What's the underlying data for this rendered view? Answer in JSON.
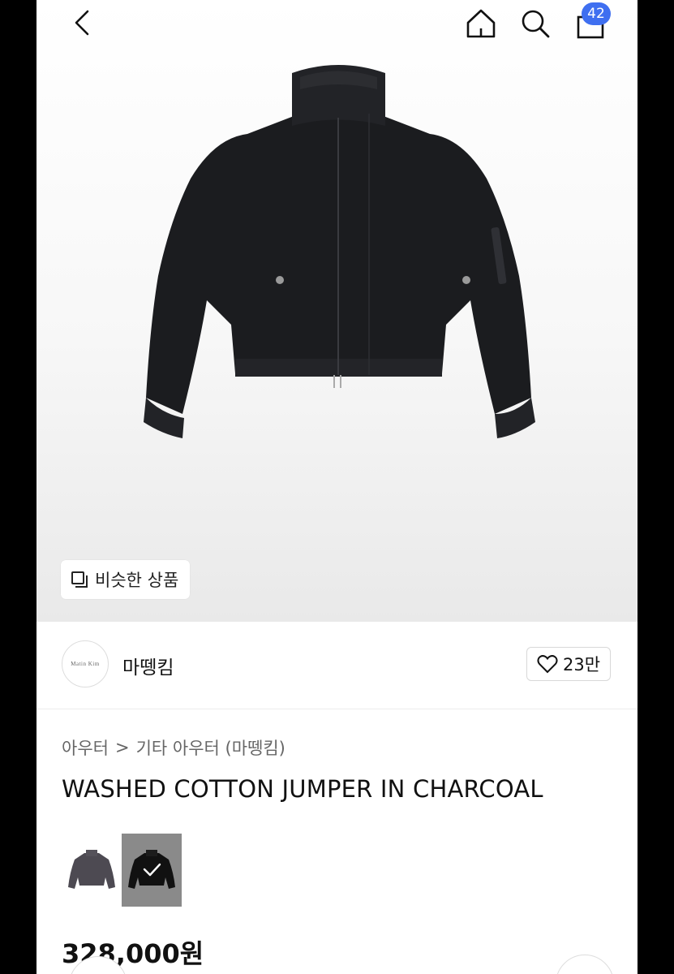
{
  "header": {
    "cart_badge": "42",
    "icons": [
      "back-icon",
      "home-icon",
      "search-icon",
      "cart-icon"
    ]
  },
  "hero": {
    "similar_products_label": "비슷한 상품"
  },
  "store": {
    "logo_text": "Matin Kim",
    "name": "마뗑킴",
    "likes": "23만"
  },
  "breadcrumb": {
    "category": "아우터",
    "separator": ">",
    "subcategory": "기타 아우터 (마뗑킴)"
  },
  "product": {
    "title": "WASHED COTTON JUMPER IN CHARCOAL",
    "price": "328,000원",
    "color_options": [
      "charcoal-grey",
      "black"
    ],
    "selected_color": "black"
  },
  "colors": {
    "accent": "#3f6ff0",
    "product": "#1b1c1f"
  }
}
